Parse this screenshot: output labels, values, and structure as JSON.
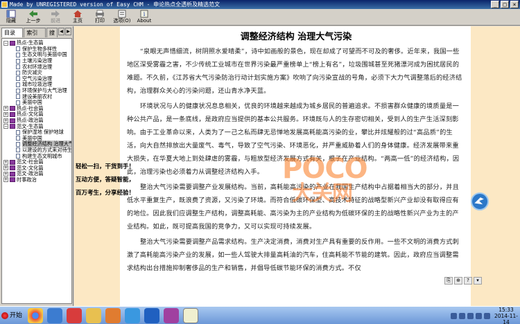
{
  "window": {
    "title": "Made by UNREGISTERED version of Easy CHM - 申论热点全透析及精选范文"
  },
  "toolbar": {
    "buttons": [
      {
        "label": "隐藏",
        "icon": "hide-icon"
      },
      {
        "label": "上一步",
        "icon": "back-icon"
      },
      {
        "label": "前进",
        "icon": "forward-icon"
      },
      {
        "label": "主页",
        "icon": "home-icon"
      },
      {
        "label": "打印",
        "icon": "print-icon"
      },
      {
        "label": "选项(O)",
        "icon": "options-icon"
      },
      {
        "label": "About",
        "icon": "about-icon"
      }
    ]
  },
  "sidebar": {
    "tabs": [
      {
        "label": "目录(C)"
      },
      {
        "label": "索引(N)"
      },
      {
        "label": "搜"
      }
    ],
    "tree": [
      {
        "label": "热点-生态篇",
        "level": 0,
        "type": "book",
        "expanded": true
      },
      {
        "label": "保护生物多样性",
        "level": 1,
        "type": "page"
      },
      {
        "label": "生态文明与美丽中国",
        "level": 1,
        "type": "page"
      },
      {
        "label": "土壤污染治理",
        "level": 1,
        "type": "page"
      },
      {
        "label": "农村环境治理",
        "level": 1,
        "type": "page"
      },
      {
        "label": "防灾减灾",
        "level": 1,
        "type": "page"
      },
      {
        "label": "空气污染治理",
        "level": 1,
        "type": "page"
      },
      {
        "label": "城市垃圾治理",
        "level": 1,
        "type": "page"
      },
      {
        "label": "环境保护与大气治理",
        "level": 1,
        "type": "page"
      },
      {
        "label": "建设美丽农村",
        "level": 1,
        "type": "page"
      },
      {
        "label": "美丽中国",
        "level": 1,
        "type": "page"
      },
      {
        "label": "热点-社会篇",
        "level": 0,
        "type": "book",
        "expanded": false
      },
      {
        "label": "热点-文化篇",
        "level": 0,
        "type": "book",
        "expanded": false
      },
      {
        "label": "热点-政治篇",
        "level": 0,
        "type": "book",
        "expanded": false
      },
      {
        "label": "范文-生态篇",
        "level": 0,
        "type": "book",
        "expanded": true
      },
      {
        "label": "保护湿地 保护地球",
        "level": 1,
        "type": "page"
      },
      {
        "label": "美丽中国",
        "level": 1,
        "type": "page"
      },
      {
        "label": "调整经济结构 治理大气污染",
        "level": 1,
        "type": "page",
        "selected": true
      },
      {
        "label": "以建设的方式来对待生态",
        "level": 1,
        "type": "page"
      },
      {
        "label": "构建生态文明城市",
        "level": 1,
        "type": "page"
      },
      {
        "label": "范文-社会篇",
        "level": 0,
        "type": "book",
        "expanded": false
      },
      {
        "label": "范文-文化篇",
        "level": 0,
        "type": "book",
        "expanded": false
      },
      {
        "label": "范文-政治篇",
        "level": 0,
        "type": "book",
        "expanded": false
      },
      {
        "label": "时事政治",
        "level": 0,
        "type": "book",
        "expanded": false
      }
    ]
  },
  "article": {
    "title": "调整经济结构 治理大气污染",
    "paragraphs": [
      "“泉眼无声惜细流，树阴照水爱晴柔”，诗中如画般的景色，现在却成了可望而不可及的奢侈。近年来，我国一些地区深受雾霾之害，不少传统工业城市在世界污染最严重榜单上“榜上有名”，垃圾围城甚至死猪漂河成为困扰居民的难题。不久前，《江苏省大气污染防治行动计划实施方案》吹响了向污染宣战的号角，必须下大力气调整落后的经济结构，治理群众关心的污染问题，还山青水净天蓝。",
      "环境状况与人的健康状况息息相关，优良的环境越来越成为城乡居民的普遍追求。不损害群众健康的境质量是一种公共产品，是一条底线，是政府应当提供的基本公共服务。环境既与人的生存密切相关，受到人的生产生活深刻影响。由于工业革命以来，人类为了一己之私而肆无忌惮地发展高耗能高污染的业，攀比并炫耀般的过“高品质”的生活，向大自然排放出大量废气、毒气，导致了空气污染、环境恶化，并严重威胁着人们的身体健康。经济发展带来重大损失，在华夏大地上到处肆虐的雾霾，与粗放型经济发展方式有关，根子在产业结构。“两高一低”的经济结构，因此，治理污染也必须着力从调整经济结构入手。",
      "整治大气污染需要调整产业发展结构。当前，高耗能高污染的产业在我国生产结构中占据着相当大的部分，并且低水平重复生产，既浪费了资源，又污染了环境。而符合低碳环保型、高技术特征的战略型新兴产业却没有取得应有的地位。因此我们应调整生产结构，调整高耗能、高污染为主的产业结构为低碳环保的主的战略性新兴产业为主的产业结构。如此，既可提高我国的竞争力，又可以实现可持续发展。",
      "整治大气污染需要调整产品需求结构。生产决定消费，消费对生产具有重要的反作用。一些不文明的消费方式刺激了高耗能高污染产业的发展，如一些人驾驶大排量高耗油的汽车，住高耗能不节能的建筑。因此，政府应当调整需求结构出台措施抑制奢侈品的生产和销售，并倡导低碳节能环保的消费方式。不仅"
    ]
  },
  "side_caption": "轻松一扫，干货到手！互动方便，答疑智能，百万考生，分享经验！",
  "watermark": {
    "line1": "POCO",
    "line2": "大关网"
  },
  "taskbar": {
    "start_label": "开始",
    "apps": [
      "chrome-icon",
      "bird-icon",
      "red-app-icon",
      "folder-icon",
      "media-icon",
      "ie-icon",
      "player-icon",
      "archive-icon",
      "notepad-icon"
    ],
    "time": "15:33",
    "date": "2014-11-14"
  },
  "colors": {
    "paper_margin": "#fce8c4",
    "titlebar": "#0a246a",
    "watermark": "#fa7820",
    "taskbar": "#6c98d8"
  }
}
